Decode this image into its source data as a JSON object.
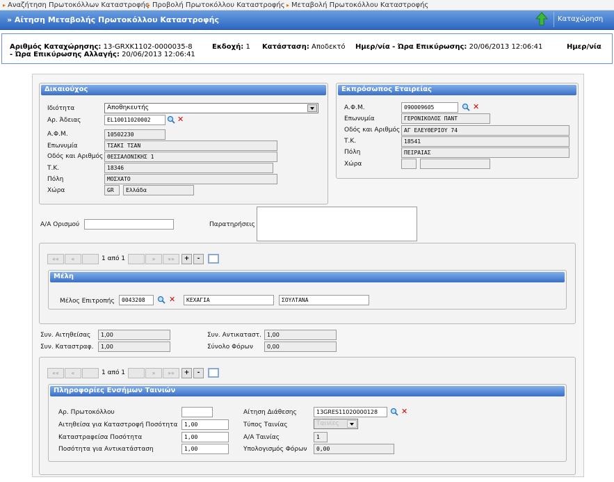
{
  "breadcrumb": {
    "items": [
      "Αναζήτηση Πρωτοκόλλων Καταστροφής",
      "Προβολή Πρωτοκόλλου Καταστροφής",
      "Μεταβολή Πρωτοκόλλου Καταστροφής"
    ]
  },
  "header": {
    "title": "» Αίτηση Μεταβολής Πρωτοκόλλου Καταστροφής",
    "save_label": "Καταχώρηση"
  },
  "info": {
    "reg_label": "Αριθμός Καταχώρησης:",
    "reg_value": "13-GRXK1102-0000035-8",
    "version_label": "Εκδοχή:",
    "version_value": "1",
    "status_label": "Κατάσταση:",
    "status_value": "Αποδεκτό",
    "date1_label": "Ημερ/νία - Ώρα Επικύρωσης:",
    "date1_value": "20/06/2013 12:06:41",
    "date2_label_a": "Ημερ/νία",
    "date2_label_b": "- Ώρα Επικύρωσης Αλλαγής:",
    "date2_value": "20/06/2013 12:06:41"
  },
  "holder": {
    "title": "Δικαιούχος",
    "property_label": "Ιδιότητα",
    "property_value": "Αποθηκευτής",
    "permit_label": "Αρ. Άδειας",
    "permit_value": "EL10011020002",
    "afm_label": "Α.Φ.Μ.",
    "afm_value": "10502230",
    "name_label": "Επωνυμία",
    "name_value": "ΤΣΑΚΙ  ΤΣΑΝ",
    "street_label": "Οδός και Αριθμός",
    "street_value": "ΘΕΣΣΑΛΟΝΙΚΗΣ 1",
    "tk_label": "Τ.Κ.",
    "tk_value": "18346",
    "city_label": "Πόλη",
    "city_value": "ΜΟΣΧΑΤΟ",
    "country_label": "Χώρα",
    "country_code": "GR",
    "country_name": "Ελλάδα"
  },
  "rep": {
    "title": "Εκπρόσωπος Εταιρείας",
    "afm_label": "Α.Φ.Μ.",
    "afm_value": "090009605",
    "name_label": "Επωνυμία",
    "name_value": "ΓΕΡΟΝΙΚΟΛΟΣ ΠΑΝΤ",
    "street_label": "Οδός και Αριθμός",
    "street_value": "ΑΓ ΕΛΕΥΘΕΡΙΟΥ 74",
    "tk_label": "Τ.Κ.",
    "tk_value": "18541",
    "city_label": "Πόλη",
    "city_value": "ΠΕΙΡΑΙΑΣ",
    "country_label": "Χώρα",
    "country_code": "",
    "country_name": ""
  },
  "misc": {
    "aa_label": "Α/Α Ορισμού",
    "aa_value": "",
    "notes_label": "Παρατηρήσεις"
  },
  "pager1": {
    "first": "««",
    "prev": "«",
    "info": "1 από 1",
    "next": "»",
    "last": "»»",
    "add": "+",
    "remove": "-"
  },
  "members": {
    "title": "Μέλη",
    "member_label": "Μέλος Επιτροπής",
    "member_code": "0043208",
    "surname": "ΚΕΧΑΓΙΑ",
    "firstname": "ΣΟΥΛΤΑΝΑ"
  },
  "coeffs": {
    "req_label": "Συν. Αιτηθείσας",
    "req_value": "1,00",
    "repl_label": "Συν. Αντικαταστ.",
    "repl_value": "1,00",
    "destr_label": "Συν. Καταστραφ.",
    "destr_value": "1,00",
    "tax_label": "Σύνολο Φόρων",
    "tax_value": "0,00"
  },
  "pager2": {
    "first": "««",
    "prev": "«",
    "info": "1 από 1",
    "next": "»",
    "last": "»»",
    "add": "+",
    "remove": "-"
  },
  "tapes": {
    "title": "Πληροφορίες Ενσήμων Ταινιών",
    "proto_label": "Αρ. Πρωτοκόλλου",
    "proto_value": "",
    "disposal_label": "Αίτηση Διάθεσης",
    "disposal_value": "13GRES11020000128",
    "req_qty_label": "Αιτηθείσα για Καταστροφή Ποσότητα",
    "req_qty_value": "1,00",
    "type_label": "Τύπος Ταινίας",
    "type_value": "Ταινίες",
    "destr_qty_label": "Καταστραφείσα Ποσότητα",
    "destr_qty_value": "1,00",
    "aa_label": "Α/Α Ταινίας",
    "aa_value": "1",
    "repl_qty_label": "Ποσότητα για Αντικατάσταση",
    "repl_qty_value": "1,00",
    "tax_label": "Υπολογισμός Φόρων",
    "tax_value": "0,00"
  },
  "colors": {
    "accent": "#3c70c8",
    "delete": "#dd0000"
  }
}
